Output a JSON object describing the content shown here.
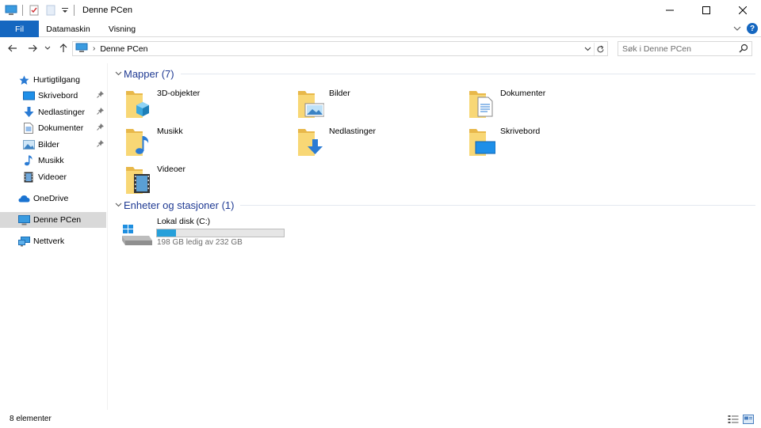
{
  "window": {
    "title": "Denne PCen"
  },
  "ribbon": {
    "tabs": [
      "Fil",
      "Datamaskin",
      "Visning"
    ]
  },
  "address": {
    "crumb": "Denne PCen"
  },
  "search": {
    "placeholder": "Søk i Denne PCen"
  },
  "sidebar": {
    "quick_access": "Hurtigtilgang",
    "items": [
      {
        "label": "Skrivebord",
        "icon": "desktop-icon",
        "pinned": true
      },
      {
        "label": "Nedlastinger",
        "icon": "download-icon",
        "pinned": true
      },
      {
        "label": "Dokumenter",
        "icon": "document-icon",
        "pinned": true
      },
      {
        "label": "Bilder",
        "icon": "pictures-icon",
        "pinned": true
      },
      {
        "label": "Musikk",
        "icon": "music-icon",
        "pinned": false
      },
      {
        "label": "Videoer",
        "icon": "video-icon",
        "pinned": false
      }
    ],
    "onedrive": "OneDrive",
    "this_pc": "Denne PCen",
    "network": "Nettverk"
  },
  "groups": {
    "folders_header": "Mapper (7)",
    "devices_header": "Enheter og stasjoner (1)"
  },
  "folders": [
    {
      "label": "3D-objekter",
      "icon": "3d-objects-folder-icon"
    },
    {
      "label": "Bilder",
      "icon": "pictures-folder-icon"
    },
    {
      "label": "Dokumenter",
      "icon": "documents-folder-icon"
    },
    {
      "label": "Musikk",
      "icon": "music-folder-icon"
    },
    {
      "label": "Nedlastinger",
      "icon": "downloads-folder-icon"
    },
    {
      "label": "Skrivebord",
      "icon": "desktop-folder-icon"
    },
    {
      "label": "Videoer",
      "icon": "videos-folder-icon"
    }
  ],
  "drive": {
    "name": "Lokal disk (C:)",
    "info": "198 GB ledig av 232 GB",
    "used_fraction": 0.147
  },
  "status": {
    "count": "8 elementer"
  },
  "colors": {
    "accent": "#1567c0",
    "folder": "#f8d775",
    "drive_fill": "#26a0da",
    "group_header": "#1f3a93"
  }
}
